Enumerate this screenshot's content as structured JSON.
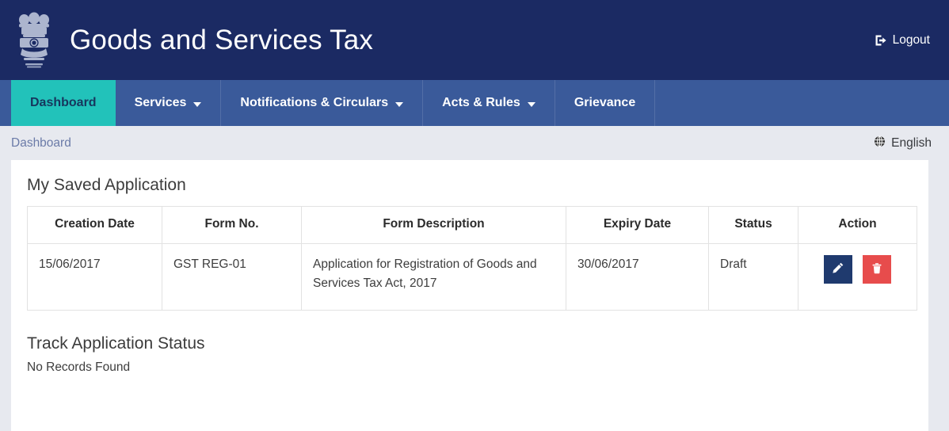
{
  "header": {
    "emblem_icon": "india-state-emblem-icon",
    "brand_title": "Goods and Services Tax",
    "logout_label": "Logout",
    "logout_icon": "sign-out-icon",
    "bg_color": "#1b2a63"
  },
  "nav": {
    "bg_color": "#3a5a9a",
    "active_color": "#22c2ba",
    "items": [
      {
        "label": "Dashboard",
        "has_caret": false,
        "active": true
      },
      {
        "label": "Services",
        "has_caret": true,
        "active": false
      },
      {
        "label": "Notifications & Circulars",
        "has_caret": true,
        "active": false
      },
      {
        "label": "Acts & Rules",
        "has_caret": true,
        "active": false
      },
      {
        "label": "Grievance",
        "has_caret": false,
        "active": false
      }
    ]
  },
  "breadcrumb": {
    "items": [
      {
        "label": "Dashboard"
      }
    ],
    "language_label": "English",
    "language_icon": "globe-icon"
  },
  "main": {
    "saved_application": {
      "title": "My Saved Application",
      "columns": [
        "Creation Date",
        "Form No.",
        "Form Description",
        "Expiry Date",
        "Status",
        "Action"
      ],
      "rows": [
        {
          "creation_date": "15/06/2017",
          "form_no": "GST REG-01",
          "form_description": "Application for Registration of Goods and Services Tax Act, 2017",
          "expiry_date": "30/06/2017",
          "status": "Draft",
          "actions": [
            {
              "name": "edit",
              "icon": "pencil-icon",
              "color": "#1f3a6e"
            },
            {
              "name": "delete",
              "icon": "trash-icon",
              "color": "#e74c4c"
            }
          ]
        }
      ]
    },
    "track_application": {
      "title": "Track Application Status",
      "empty_message": "No Records Found"
    }
  }
}
